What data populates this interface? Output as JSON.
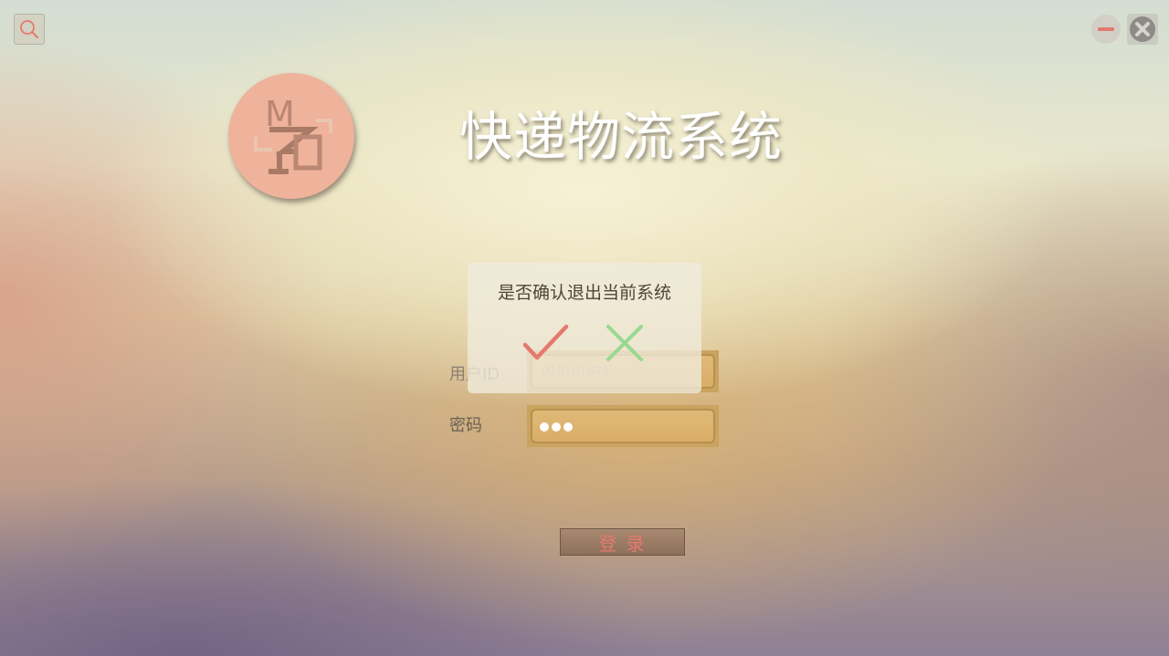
{
  "window": {
    "search_icon": "search-icon",
    "minimize_icon": "minimize-icon",
    "close_icon": "close-icon"
  },
  "logo": {
    "text": "MZJ"
  },
  "header": {
    "title": "快递物流系统"
  },
  "form": {
    "userid_label": "用户ID",
    "userid_value": "010101679",
    "password_label": "密码",
    "password_masked_length": 3,
    "login_label": "登 录"
  },
  "dialog": {
    "message": "是否确认退出当前系统",
    "confirm_icon": "check-icon",
    "cancel_icon": "cross-icon"
  },
  "colors": {
    "logo_bg": "#efb29a",
    "accent_red": "#e4796e",
    "confirm_green": "#98d98f",
    "input_bg": "#d9ad67"
  }
}
